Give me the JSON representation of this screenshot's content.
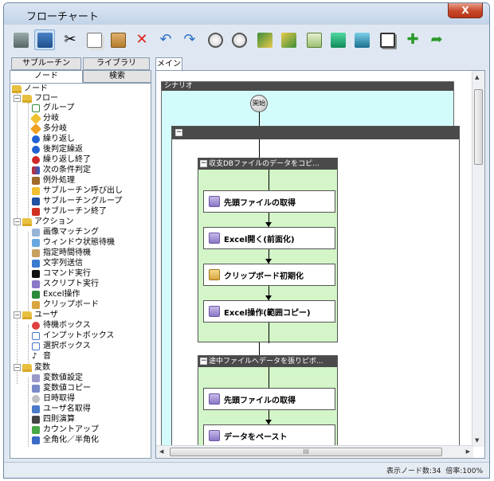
{
  "window": {
    "title": "フローチャート",
    "close_label": "X"
  },
  "toolbar": {
    "icons": [
      "new-icon",
      "save-icon",
      "cut-icon",
      "copy-icon",
      "paste-icon",
      "delete-icon",
      "undo-icon",
      "redo-icon",
      "zoom-in-icon",
      "zoom-out-icon",
      "export-icon",
      "import-icon",
      "settings-icon",
      "upload-icon",
      "download-icon",
      "window-icon",
      "add-icon",
      "exit-icon"
    ]
  },
  "left_tabs": {
    "subroutine": "サブルーチン",
    "library": "ライブラリ",
    "node": "ノード",
    "search": "検索"
  },
  "tree": {
    "root": "ノード",
    "flow": {
      "label": "フロー",
      "items": [
        "グループ",
        "分岐",
        "多分岐",
        "繰り返し",
        "後判定繰返",
        "繰り返し終了",
        "次の条件判定",
        "例外処理",
        "サブルーチン呼び出し",
        "サブルーチングループ",
        "サブルーチン終了"
      ]
    },
    "action": {
      "label": "アクション",
      "items": [
        "画像マッチング",
        "ウィンドウ状態待機",
        "指定時間待機",
        "文字列送信",
        "コマンド実行",
        "スクリプト実行",
        "Excel操作",
        "クリップボード"
      ]
    },
    "user": {
      "label": "ユーザ",
      "items": [
        "待機ボックス",
        "インプットボックス",
        "選択ボックス",
        "音"
      ]
    },
    "variable": {
      "label": "変数",
      "items": [
        "変数値設定",
        "変数値コピー",
        "日時取得",
        "ユーザ名取得",
        "四則演算",
        "カウントアップ",
        "全角化／半角化"
      ]
    }
  },
  "main": {
    "tab": "メイン",
    "scenario_label": "シナリオ",
    "start_label": "開始",
    "group_toggle": "−",
    "groups": [
      {
        "title": "収支DBファイルのデータをコピ...",
        "nodes": [
          "先頭ファイルの取得",
          "Excel開く(前面化)",
          "クリップボード初期化",
          "Excel操作(範囲コピー)"
        ]
      },
      {
        "title": "途中ファイルへデータを張りピボ...",
        "nodes": [
          "先頭ファイルの取得",
          "データをペースト"
        ]
      }
    ],
    "hscroll_grip": "III"
  },
  "status": {
    "node_count_label": "表示ノード数:",
    "node_count": "34",
    "zoom_label": "倍率:",
    "zoom": "100%"
  }
}
